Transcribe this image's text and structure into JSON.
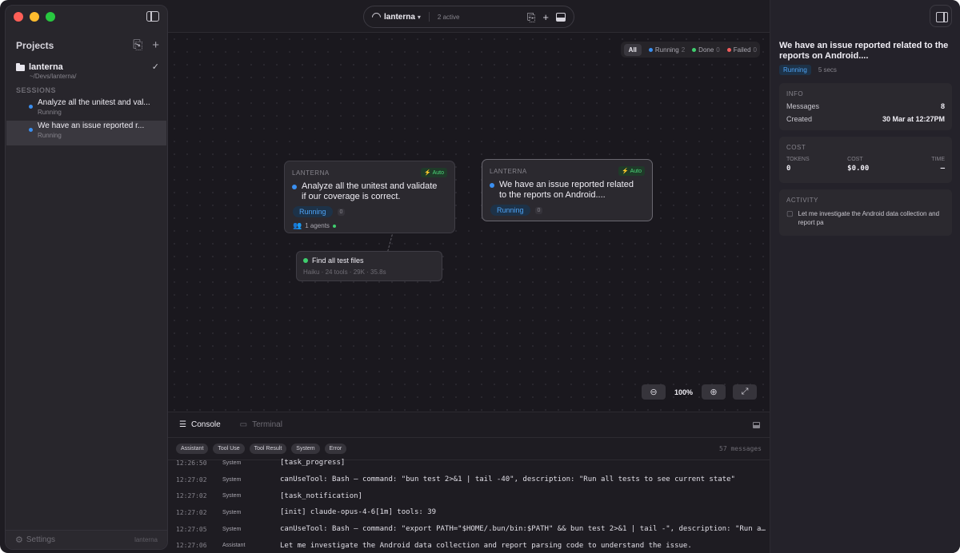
{
  "sidebar": {
    "projects_title": "Projects",
    "project": {
      "name": "lanterna",
      "path": "~/Devs/lanterna/"
    },
    "sessions_label": "SESSIONS",
    "sessions": [
      {
        "title": "Analyze all the unitest and val...",
        "status": "Running"
      },
      {
        "title": "We have an issue reported r...",
        "status": "Running"
      }
    ],
    "settings_label": "Settings",
    "settings_project": "lanterna"
  },
  "topbar": {
    "project": "lanterna",
    "active": "2 active"
  },
  "filters": {
    "all": "All",
    "running": {
      "label": "Running",
      "count": "2",
      "color": "#3b8ff0"
    },
    "done": {
      "label": "Done",
      "count": "0",
      "color": "#3fce6e"
    },
    "failed": {
      "label": "Failed",
      "count": "0",
      "color": "#f25c5c"
    }
  },
  "nodes": [
    {
      "project": "LANTERNA",
      "badge": "Auto",
      "title_line1": "Analyze all the unitest and validate",
      "title_line2": "if our coverage is correct.",
      "status": "Running",
      "count": "0",
      "agents": "1 agents"
    },
    {
      "project": "LANTERNA",
      "badge": "Auto",
      "title_line1": "We have an issue reported related",
      "title_line2": "to the reports on Android....",
      "status": "Running",
      "count": "0"
    }
  ],
  "subnode": {
    "title": "Find all test files",
    "meta": "Haiku · 24 tools · 29K · 35.8s"
  },
  "zoom": {
    "level": "100%"
  },
  "console": {
    "tab_console": "Console",
    "tab_terminal": "Terminal",
    "chips": [
      "Assistant",
      "Tool Use",
      "Tool Result",
      "System",
      "Error"
    ],
    "message_count": "57 messages",
    "logs": [
      {
        "time": "12:26:50",
        "role": "System",
        "text": "[task_progress]"
      },
      {
        "time": "12:27:02",
        "role": "System",
        "text": "canUseTool: Bash — command: \"bun test 2>&1 | tail -40\", description: \"Run all tests to see current state\""
      },
      {
        "time": "12:27:02",
        "role": "System",
        "text": "[task_notification]"
      },
      {
        "time": "12:27:02",
        "role": "System",
        "text": "[init] claude-opus-4-6[1m] tools: 39"
      },
      {
        "time": "12:27:05",
        "role": "System",
        "text": "canUseTool: Bash — command: \"export PATH=\"$HOME/.bun/bin:$PATH\" && bun test 2>&1 | tail -\", description: \"Run al..."
      },
      {
        "time": "12:27:06",
        "role": "Assistant",
        "text": "Let me investigate the Android data collection and report parsing code to understand the issue."
      }
    ]
  },
  "detail": {
    "title": "We have an issue reported related to the reports on Android....",
    "status": "Running",
    "elapsed": "5 secs",
    "info_label": "INFO",
    "messages_key": "Messages",
    "messages_val": "8",
    "created_key": "Created",
    "created_val": "30 Mar at 12:27PM",
    "cost_label": "COST",
    "tokens_key": "TOKENS",
    "tokens_val": "0",
    "cost_key": "COST",
    "cost_val": "$0.00",
    "time_key": "TIME",
    "time_val": "—",
    "activity_label": "ACTIVITY",
    "activity_text": "Let me investigate the Android data collection and report pa"
  }
}
